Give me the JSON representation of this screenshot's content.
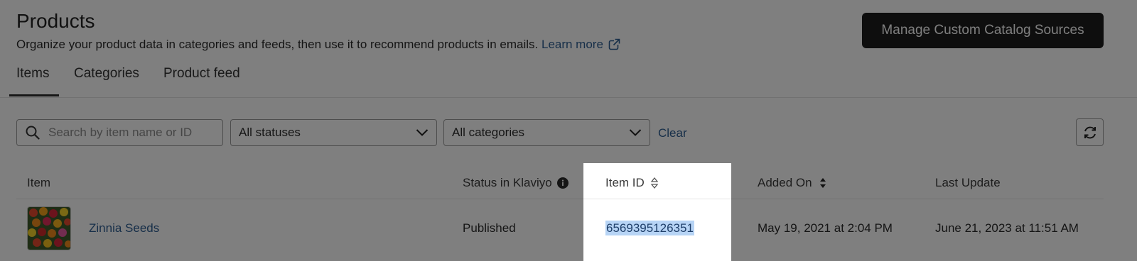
{
  "header": {
    "title": "Products",
    "subtitle": "Organize your product data in categories and feeds, then use it to recommend products in emails.",
    "learn_more": "Learn more",
    "manage_button": "Manage Custom Catalog Sources"
  },
  "tabs": [
    {
      "label": "Items",
      "active": true
    },
    {
      "label": "Categories",
      "active": false
    },
    {
      "label": "Product feed",
      "active": false
    }
  ],
  "filters": {
    "search_placeholder": "Search by item name or ID",
    "status_select": "All statuses",
    "category_select": "All categories",
    "clear": "Clear"
  },
  "table": {
    "columns": [
      "Item",
      "Status in Klaviyo",
      "Item ID",
      "Added On",
      "Last Update"
    ],
    "rows": [
      {
        "item": "Zinnia Seeds",
        "status": "Published",
        "item_id": "6569395126351",
        "added_on": "May 19, 2021 at 2:04 PM",
        "last_update": "June 21, 2023 at 11:51 AM"
      }
    ]
  },
  "colors": {
    "link": "#2f5f93",
    "primary_button": "#1c1c1c",
    "selection": "#b7d4f5",
    "dim_overlay": "rgba(0,0,0,0.5)"
  },
  "icons": [
    "external-link-icon",
    "search-icon",
    "chevron-down-icon",
    "refresh-icon",
    "info-icon",
    "sort-icon"
  ]
}
